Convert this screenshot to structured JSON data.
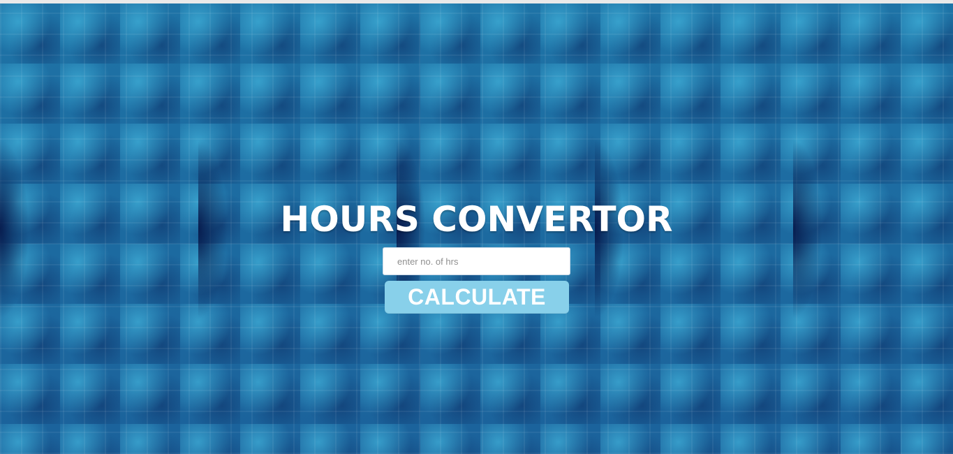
{
  "page": {
    "title": "HOURS CONVERTOR"
  },
  "form": {
    "hours_input": {
      "value": "",
      "placeholder": "enter no. of hrs"
    },
    "calculate_label": "CALCULATE"
  },
  "colors": {
    "background_primary": "#1e73a6",
    "background_dark_band": "#051446",
    "title_text": "#ffffff",
    "button_bg": "#88d0ea",
    "button_text": "#ffffff",
    "input_bg": "#ffffff",
    "placeholder_text": "#8f8f8f"
  }
}
